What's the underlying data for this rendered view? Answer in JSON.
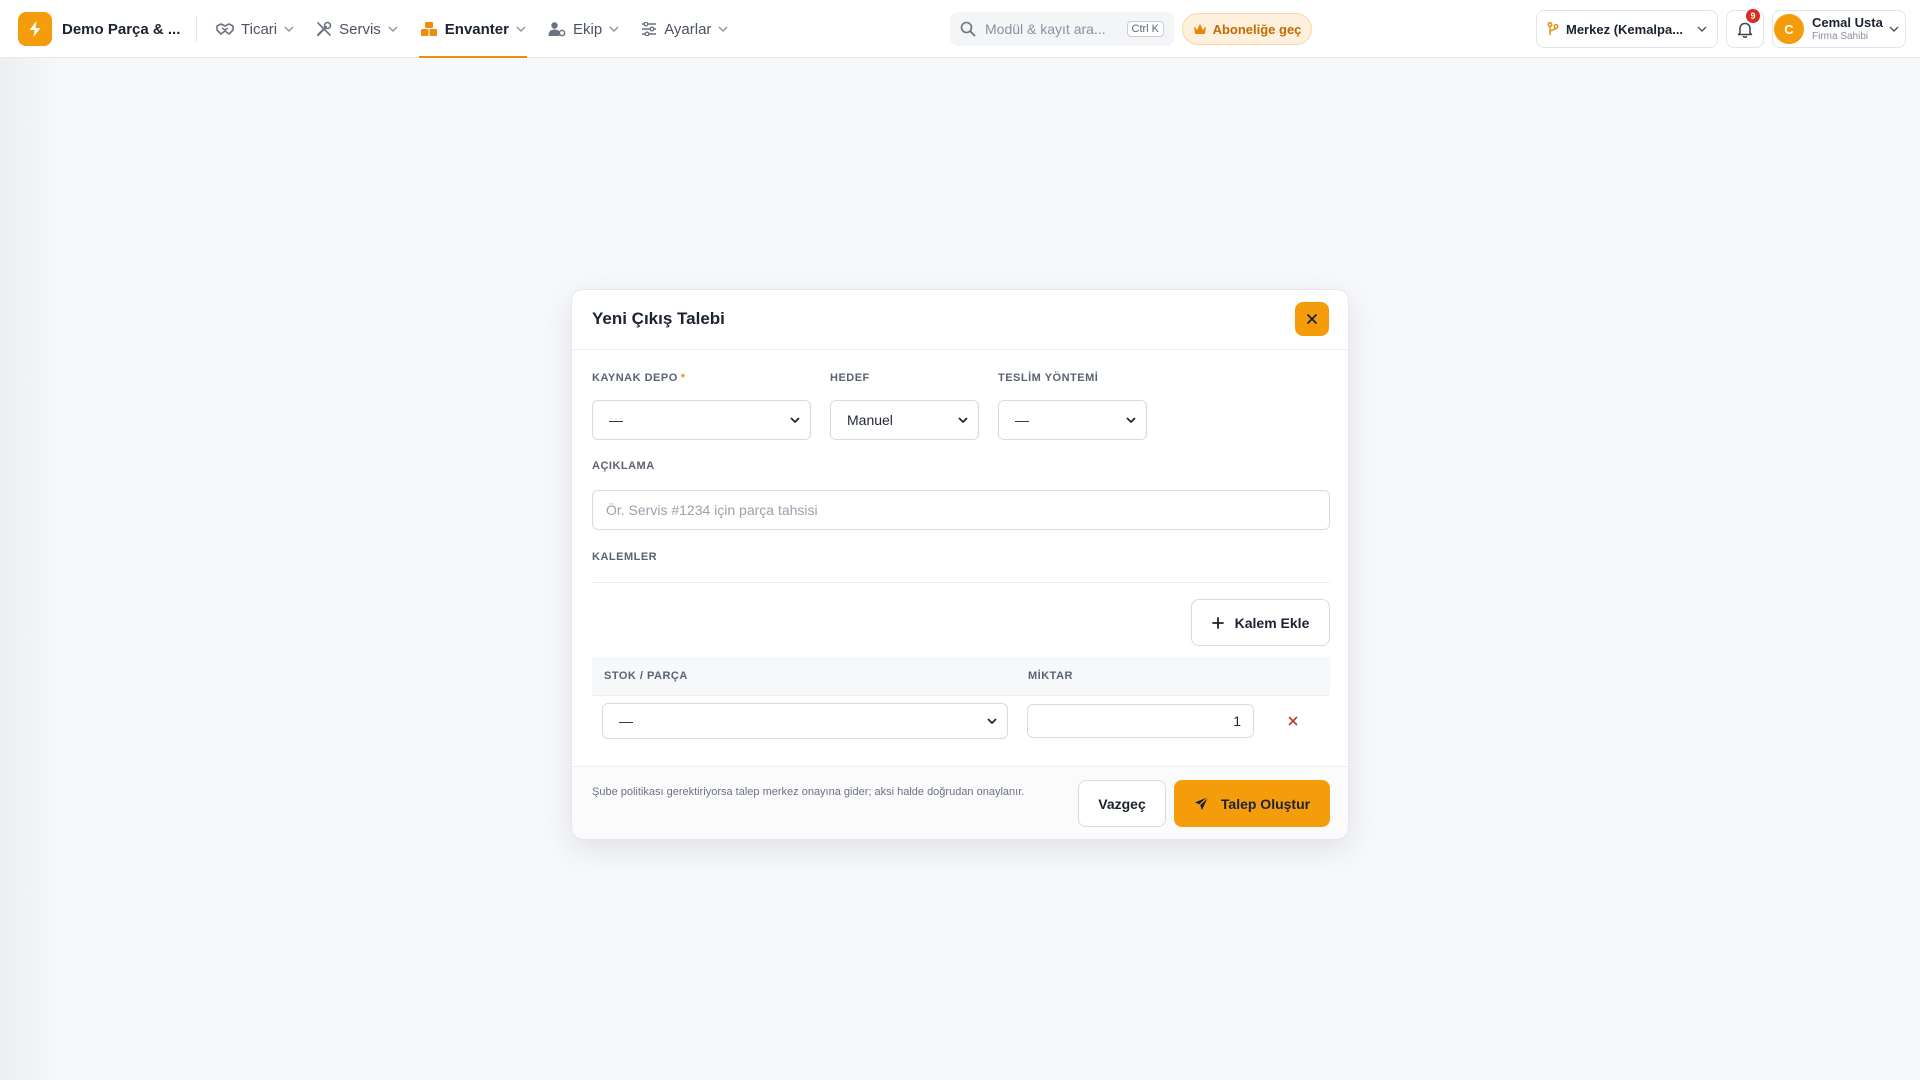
{
  "app": {
    "brand_name": "Demo Parça & ...",
    "accent_color": "#f59c0b"
  },
  "nav": {
    "items": [
      {
        "label": "Ticari",
        "icon": "handshake-icon",
        "active": false
      },
      {
        "label": "Servis",
        "icon": "tools-icon",
        "active": false
      },
      {
        "label": "Envanter",
        "icon": "boxes-icon",
        "active": true
      },
      {
        "label": "Ekip",
        "icon": "user-gear-icon",
        "active": false
      },
      {
        "label": "Ayarlar",
        "icon": "sliders-icon",
        "active": false
      }
    ]
  },
  "search": {
    "placeholder": "Modül & kayıt ara...",
    "shortcut": "Ctrl K"
  },
  "subscribe": {
    "label": "Aboneliğe geç",
    "icon": "crown-icon"
  },
  "branch": {
    "label": "Merkez (Kemalpa...",
    "icon": "branch-icon"
  },
  "notifications": {
    "count": "9",
    "badge_color": "#d92d20"
  },
  "user": {
    "initial": "C",
    "name": "Cemal Usta",
    "role": "Firma Sahibi"
  },
  "modal": {
    "title": "Yeni Çıkış Talebi",
    "fields": {
      "source_label": "KAYNAK DEPO",
      "source_required": "*",
      "source_value": "—",
      "target_label": "HEDEF",
      "target_value": "Manuel",
      "delivery_label": "TESLİM YÖNTEMİ",
      "delivery_value": "—",
      "description_label": "AÇIKLAMA",
      "description_placeholder": "Ör. Servis #1234 için parça tahsisi"
    },
    "items": {
      "section_label": "KALEMLER",
      "add_button": "Kalem Ekle",
      "col_stock": "STOK / PARÇA",
      "col_qty": "MİKTAR",
      "rows": [
        {
          "stock": "—",
          "qty": "1"
        }
      ]
    },
    "footer": {
      "note": "Şube politikası gerektiriyorsa talep merkez onayına gider; aksi halde doğrudan onaylanır.",
      "cancel": "Vazgeç",
      "submit": "Talep Oluştur"
    }
  }
}
